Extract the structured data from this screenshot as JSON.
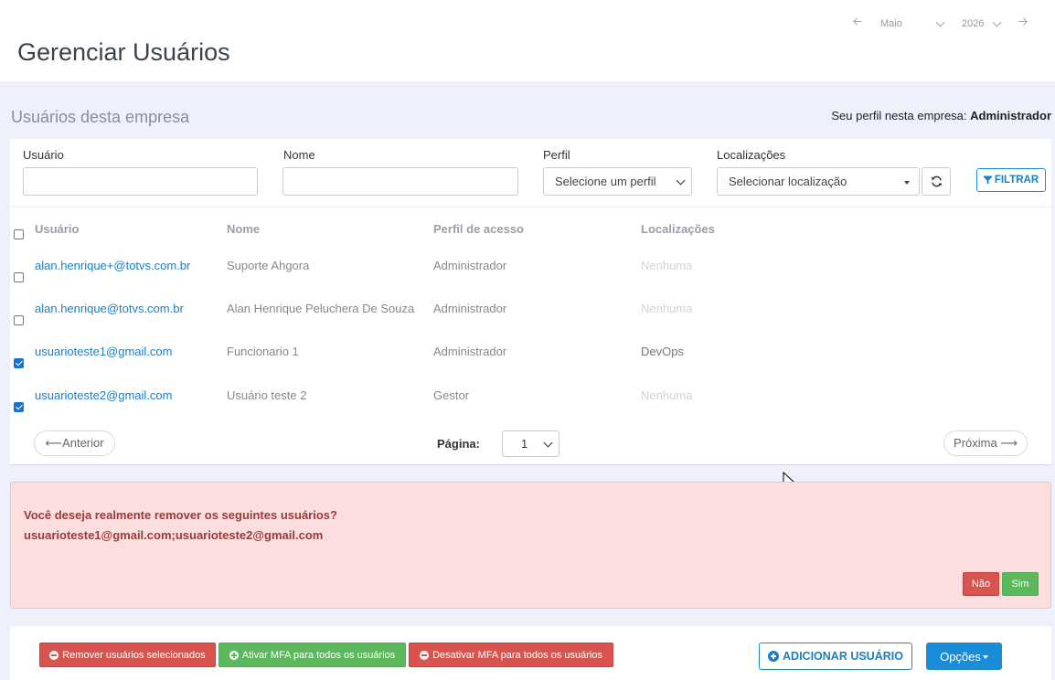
{
  "header": {
    "title": "Gerenciar Usuários",
    "date_nav": {
      "month": "Maio",
      "year": "2026"
    }
  },
  "section": {
    "title": "Usuários desta empresa",
    "profile_prefix": "Seu perfil nesta empresa:",
    "profile_value": "Administrador"
  },
  "filters": {
    "usuario_label": "Usuário",
    "usuario_value": "",
    "nome_label": "Nome",
    "nome_value": "",
    "perfil_label": "Perfil",
    "perfil_selected": "Selecione um perfil",
    "localizacoes_label": "Localizações",
    "localizacoes_selected": "Selecionar localização",
    "filter_button": "FILTRAR"
  },
  "table": {
    "columns": [
      "Usuário",
      "Nome",
      "Perfil de acesso",
      "Localizações"
    ],
    "rows": [
      {
        "checked": false,
        "usuario": "alan.henrique+@totvs.com.br",
        "nome": "Suporte Ahgora",
        "perfil": "Administrador",
        "localizacoes": "Nenhuma",
        "loc_none": true
      },
      {
        "checked": false,
        "usuario": "alan.henrique@totvs.com.br",
        "nome": "Alan Henrique Peluchera De Souza",
        "perfil": "Administrador",
        "localizacoes": "Nenhuma",
        "loc_none": true
      },
      {
        "checked": true,
        "usuario": "usuarioteste1@gmail.com",
        "nome": "Funcionario 1",
        "perfil": "Administrador",
        "localizacoes": "DevOps",
        "loc_none": false
      },
      {
        "checked": true,
        "usuario": "usuarioteste2@gmail.com",
        "nome": "Usuário teste 2",
        "perfil": "Gestor",
        "localizacoes": "Nenhuma",
        "loc_none": true
      }
    ]
  },
  "pagination": {
    "prev": "⟵Anterior",
    "page_label": "Página:",
    "page_value": "1",
    "next": "Próxima ⟶"
  },
  "confirm": {
    "message": "Você deseja realmente remover os seguintes usuários?",
    "emails": "usuarioteste1@gmail.com;usuarioteste2@gmail.com",
    "no": "Não",
    "yes": "Sim"
  },
  "actions": {
    "remove": "Remover usuários selecionados",
    "mfa_on": "Ativar MFA para todos os usuários",
    "mfa_off": "Desativar MFA para todos os usuários",
    "add_user": "ADICIONAR USUÁRIO",
    "options": "Opções"
  }
}
